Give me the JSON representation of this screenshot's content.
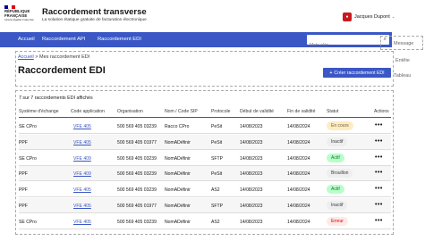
{
  "header": {
    "logo_line1": "RÉPUBLIQUE",
    "logo_line2": "FRANÇAISE",
    "logo_motto": "Liberté Égalité Fraternité",
    "site_title": "Raccordement transverse",
    "site_tagline": "La solution étatique gratuite de facturation électronique",
    "user_name": "Jacques Dupont",
    "user_caret": "⌄"
  },
  "nav": {
    "items": [
      "Accueil",
      "Raccordement API",
      "Raccordement EDI"
    ],
    "search_placeholder": "Mots clés",
    "search_icon": "⌕"
  },
  "annotations": {
    "message": "Message",
    "entete": "Entête",
    "tableau": "Tableau"
  },
  "breadcrumb": {
    "home": "Accueil",
    "separator": ">",
    "current": "Mes raccordement EDI"
  },
  "page": {
    "title": "Raccordement EDI",
    "create_button": "Créer raccordement EDI",
    "create_plus": "+"
  },
  "table": {
    "count_text": "7 sur 7 raccordements EDI affichés",
    "headers": [
      "Système d'échange",
      "Code application",
      "Organisation",
      "Nom / Code SIP",
      "Protocole",
      "Début de validité",
      "Fin de validité",
      "Statut",
      "Actions"
    ],
    "rows": [
      {
        "system": "SE CPro",
        "code": "VFE 405",
        "org": "500 569 405 03239",
        "sip": "Racco CPro",
        "proto": "PeSit",
        "start": "14/08/2023",
        "end": "14/08/2024",
        "status": "En cours",
        "status_bg": "#feecc2",
        "status_fg": "#716043",
        "actions": "•••"
      },
      {
        "system": "PPF",
        "code": "VFE 405",
        "org": "500 569 405 01977",
        "sip": "NomADéfinir",
        "proto": "PeSit",
        "start": "14/08/2023",
        "end": "14/08/2024",
        "status": "Inactif",
        "status_bg": "#eeeeee",
        "status_fg": "#3a3a3a",
        "actions": "•••"
      },
      {
        "system": "SE CPro",
        "code": "VFE 409",
        "org": "500 569 405 03239",
        "sip": "NomADéfinir",
        "proto": "SFTP",
        "start": "14/08/2023",
        "end": "14/08/2024",
        "status": "Actif",
        "status_bg": "#b8fec9",
        "status_fg": "#18753c",
        "actions": "•••"
      },
      {
        "system": "PPF",
        "code": "VFE 409",
        "org": "500 569 405 03239",
        "sip": "NomADéfinir",
        "proto": "PeSit",
        "start": "14/08/2023",
        "end": "14/08/2024",
        "status": "Brouillon",
        "status_bg": "#eeeeee",
        "status_fg": "#3a3a3a",
        "actions": "•••"
      },
      {
        "system": "PPF",
        "code": "VFE 405",
        "org": "500 569 405 03239",
        "sip": "NomADéfinir",
        "proto": "AS2",
        "start": "14/08/2023",
        "end": "14/08/2024",
        "status": "Actif",
        "status_bg": "#b8fec9",
        "status_fg": "#18753c",
        "actions": "•••"
      },
      {
        "system": "PPF",
        "code": "VFE 405",
        "org": "500 569 405 01977",
        "sip": "NomADéfinir",
        "proto": "SFTP",
        "start": "14/08/2023",
        "end": "14/08/2024",
        "status": "Inactif",
        "status_bg": "#eeeeee",
        "status_fg": "#3a3a3a",
        "actions": "•••"
      },
      {
        "system": "SE CPro",
        "code": "VFE 405",
        "org": "500 569 405 03239",
        "sip": "NomADéfinir",
        "proto": "AS2",
        "start": "14/08/2023",
        "end": "14/08/2024",
        "status": "Erreur",
        "status_bg": "#ffe9e6",
        "status_fg": "#ce0500",
        "actions": "•••"
      }
    ]
  },
  "colors": {
    "primary": "#3a57c5",
    "flag_blue": "#000091",
    "flag_red": "#e1000f"
  }
}
